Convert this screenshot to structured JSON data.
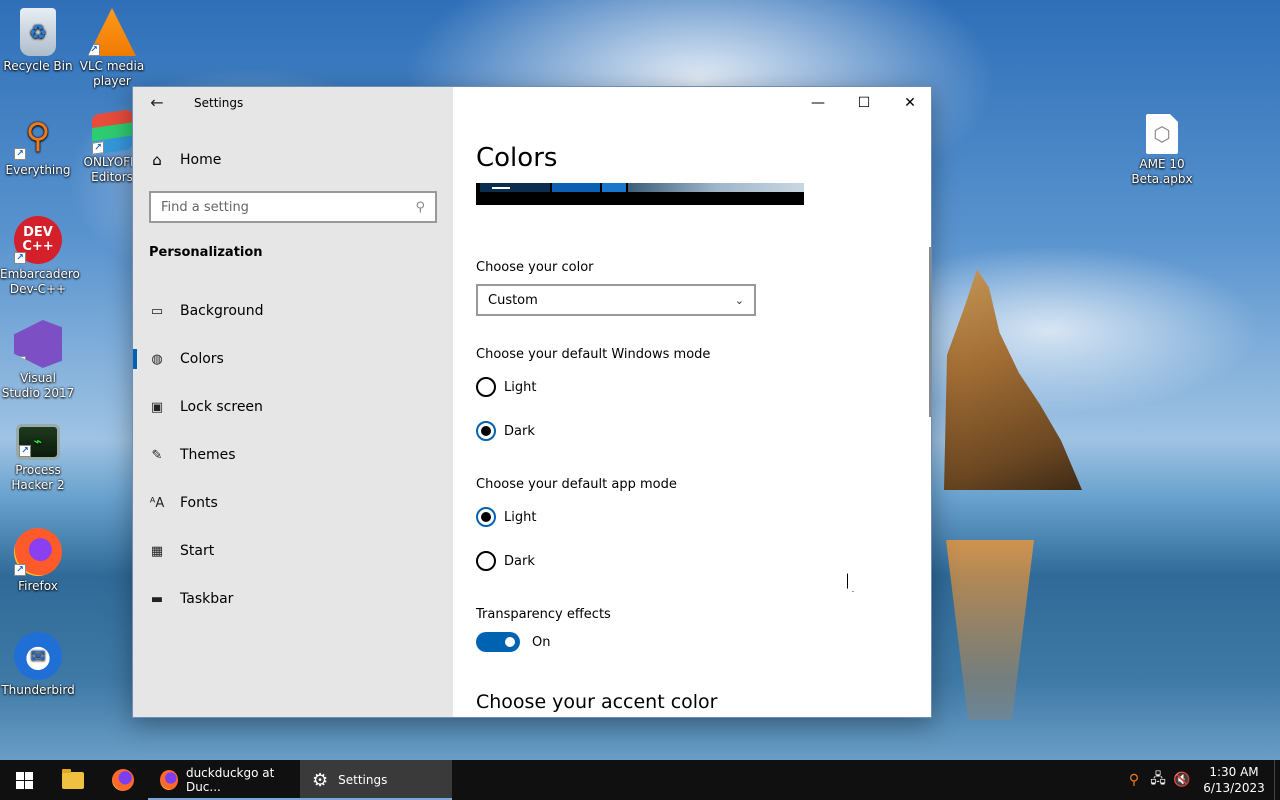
{
  "desktop": {
    "icons": [
      {
        "label": "Recycle Bin",
        "icon": "recycle-bin-icon"
      },
      {
        "label": "VLC media player",
        "icon": "vlc-icon"
      },
      {
        "label": "Everything",
        "icon": "everything-search-icon"
      },
      {
        "label": "ONLYOFFI Editors",
        "icon": "onlyoffice-icon"
      },
      {
        "label": "Embarcadero Dev-C++",
        "icon": "devcpp-icon"
      },
      {
        "label": "Visual Studio 2017",
        "icon": "visual-studio-icon"
      },
      {
        "label": "Process Hacker 2",
        "icon": "process-hacker-icon"
      },
      {
        "label": "Firefox",
        "icon": "firefox-icon"
      },
      {
        "label": "Thunderbird",
        "icon": "thunderbird-icon"
      },
      {
        "label": "AME 10 Beta.apbx",
        "icon": "apbx-file-icon"
      }
    ],
    "devcpp_badge": "DEV C++"
  },
  "window": {
    "title": "Settings",
    "nav": {
      "home": "Home",
      "search_placeholder": "Find a setting",
      "section": "Personalization",
      "items": [
        {
          "label": "Background",
          "icon": "picture-icon"
        },
        {
          "label": "Colors",
          "icon": "palette-icon",
          "active": true
        },
        {
          "label": "Lock screen",
          "icon": "lock-screen-icon"
        },
        {
          "label": "Themes",
          "icon": "themes-icon"
        },
        {
          "label": "Fonts",
          "icon": "fonts-icon"
        },
        {
          "label": "Start",
          "icon": "start-icon"
        },
        {
          "label": "Taskbar",
          "icon": "taskbar-icon"
        }
      ]
    },
    "content": {
      "title": "Colors",
      "choose_color_label": "Choose your color",
      "choose_color_value": "Custom",
      "windows_mode_label": "Choose your default Windows mode",
      "windows_mode_options": [
        "Light",
        "Dark"
      ],
      "windows_mode_selected": "Dark",
      "app_mode_label": "Choose your default app mode",
      "app_mode_options": [
        "Light",
        "Dark"
      ],
      "app_mode_selected": "Light",
      "transparency_label": "Transparency effects",
      "transparency_state": "On",
      "accent_heading": "Choose your accent color"
    },
    "accent_color": "#0063b1"
  },
  "taskbar": {
    "tasks": [
      {
        "label": "duckduckgo at Duc...",
        "icon": "firefox-icon"
      },
      {
        "label": "Settings",
        "icon": "gear-icon"
      }
    ],
    "clock_time": "1:30 AM",
    "clock_date": "6/13/2023"
  }
}
